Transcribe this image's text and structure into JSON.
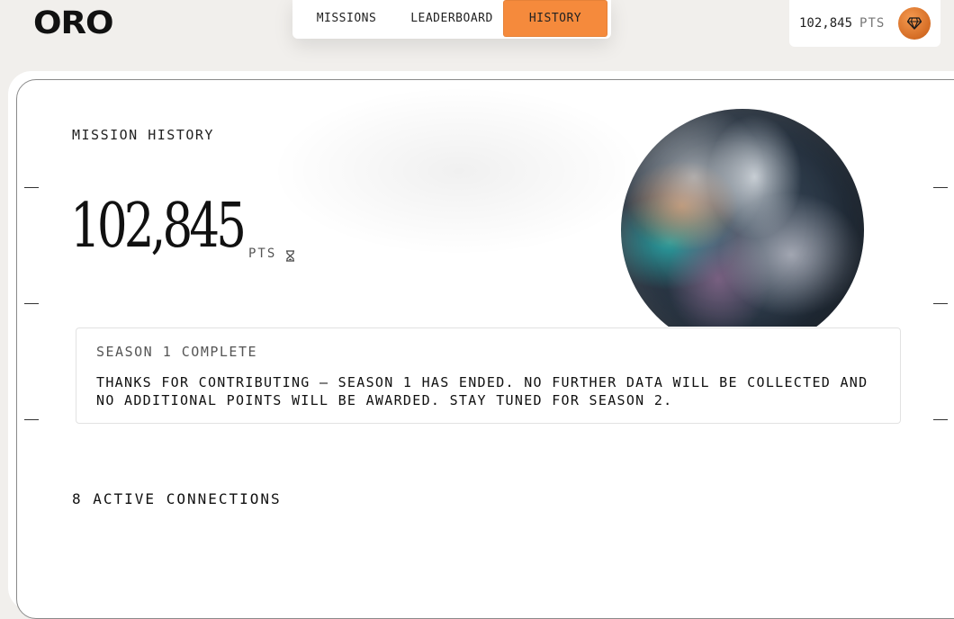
{
  "header": {
    "logo": "ORO",
    "nav_tabs": [
      {
        "label": "MISSIONS",
        "active": false
      },
      {
        "label": "LEADERBOARD",
        "active": false
      },
      {
        "label": "HISTORY",
        "active": true
      }
    ],
    "points": "102,845",
    "points_unit": "PTS",
    "badge_icon": "diamond-icon"
  },
  "main": {
    "section_title": "MISSION HISTORY",
    "total_points": "102,845",
    "total_unit": "PTS",
    "unit_icon": "hourglass-icon",
    "image": "planet-image",
    "notice": {
      "title": "SEASON 1 COMPLETE",
      "body": "THANKS FOR CONTRIBUTING – SEASON 1 HAS ENDED. NO FURTHER DATA WILL BE COLLECTED AND NO ADDITIONAL POINTS WILL BE AWARDED. STAY TUNED FOR SEASON 2."
    },
    "connections": "8 ACTIVE CONNECTIONS"
  },
  "colors": {
    "accent": "#f58a3c",
    "background": "#f1efec",
    "card": "#ffffff",
    "text": "#1a1a1a"
  }
}
